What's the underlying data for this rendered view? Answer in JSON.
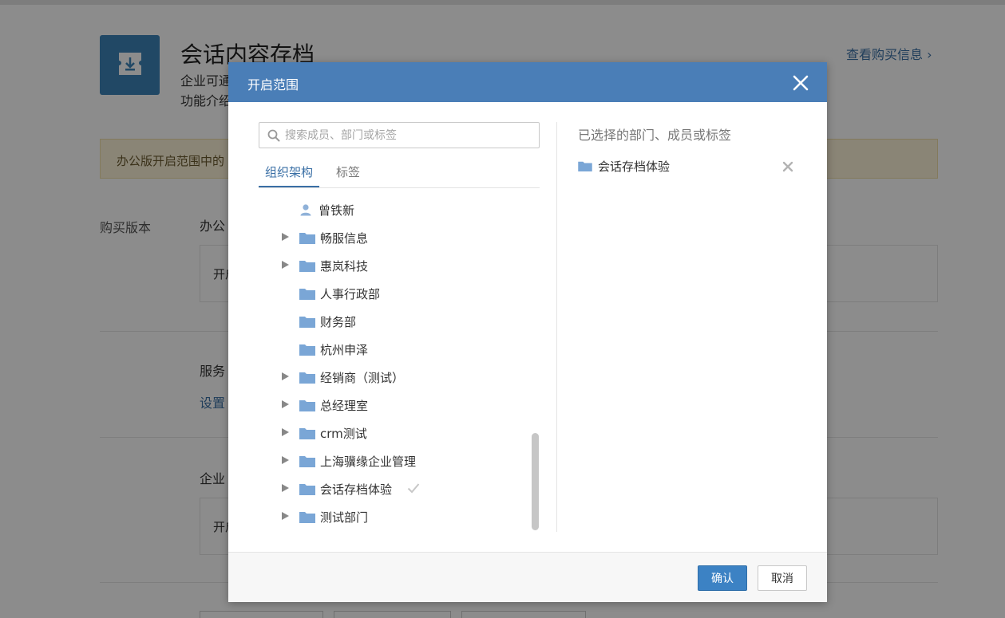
{
  "background": {
    "title": "会话内容存档",
    "subtitle1": "企业可通",
    "subtitle2": "功能介绍",
    "buy_info_link": "查看购买信息 ›",
    "notice": "办公版开启范围中的",
    "purchase_version_label": "购买版本",
    "section1_title": "办公",
    "box1_text": "开启",
    "section2_title": "服务",
    "settings_link": "设置",
    "section3_title": "企业",
    "box2_text": "开启"
  },
  "modal": {
    "title": "开启范围",
    "search": {
      "placeholder": "搜索成员、部门或标签",
      "value": ""
    },
    "tabs": [
      {
        "label": "组织架构",
        "active": true
      },
      {
        "label": "标签",
        "active": false
      }
    ],
    "tree": [
      {
        "label": "曾铁新",
        "type": "user",
        "expandable": false,
        "selected": false
      },
      {
        "label": "畅服信息",
        "type": "folder",
        "expandable": true,
        "selected": false
      },
      {
        "label": "惠岚科技",
        "type": "folder",
        "expandable": true,
        "selected": false
      },
      {
        "label": "人事行政部",
        "type": "folder",
        "expandable": false,
        "selected": false
      },
      {
        "label": "财务部",
        "type": "folder",
        "expandable": false,
        "selected": false
      },
      {
        "label": "杭州申泽",
        "type": "folder",
        "expandable": false,
        "selected": false
      },
      {
        "label": "经销商（测试）",
        "type": "folder",
        "expandable": true,
        "selected": false
      },
      {
        "label": "总经理室",
        "type": "folder",
        "expandable": true,
        "selected": false
      },
      {
        "label": "crm测试",
        "type": "folder",
        "expandable": true,
        "selected": false
      },
      {
        "label": "上海骥缘企业管理",
        "type": "folder",
        "expandable": true,
        "selected": false
      },
      {
        "label": "会话存档体验",
        "type": "folder",
        "expandable": true,
        "selected": true
      },
      {
        "label": "测试部门",
        "type": "folder",
        "expandable": true,
        "selected": false
      }
    ],
    "selected_title": "已选择的部门、成员或标签",
    "selected_items": [
      {
        "label": "会话存档体验",
        "type": "folder"
      }
    ],
    "confirm_label": "确认",
    "cancel_label": "取消"
  },
  "colors": {
    "header": "#4a7eb7",
    "primary": "#3c82c4",
    "folder": "#7aa6d6",
    "link": "#3a6fa5"
  }
}
